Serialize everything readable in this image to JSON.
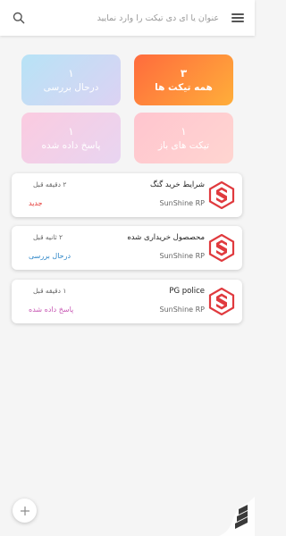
{
  "header": {
    "search_placeholder": "عنوان یا آی دی تیکت را وارد نمایید"
  },
  "tiles": {
    "all": {
      "count": "۳",
      "label": "همه تیکت ها"
    },
    "review": {
      "count": "۱",
      "label": "درحال بررسی"
    },
    "open": {
      "count": "۱",
      "label": "تیکت های باز"
    },
    "answered": {
      "count": "۱",
      "label": "پاسخ داده شده"
    }
  },
  "tickets": [
    {
      "title": "شرایط خرید گنگ",
      "owner": "SunShine RP",
      "time": "۲ دقیقه قبل",
      "status": "جدید",
      "status_color": "#e53935"
    },
    {
      "title": "محصصول خریداری شده",
      "owner": "SunShine RP",
      "time": "۲ ثانیه قبل",
      "status": "درحال بررسی",
      "status_color": "#2f87c8"
    },
    {
      "title": "PG police",
      "owner": "SunShine RP",
      "time": "۱ دقیقه قبل",
      "status": "پاسخ داده شده",
      "status_color": "#c757b3"
    }
  ],
  "colors": {
    "logo_red": "#e03a3e",
    "tile_all": "#ff7b3a",
    "tile_review": "#bfe3f5",
    "tile_open": "#ffc7cf",
    "tile_answered": "#f4cde6"
  },
  "icons": {
    "menu": "hamburger-menu-icon",
    "search": "search-icon",
    "add": "plus-icon",
    "logo": "sunshine-s-logo-icon"
  }
}
